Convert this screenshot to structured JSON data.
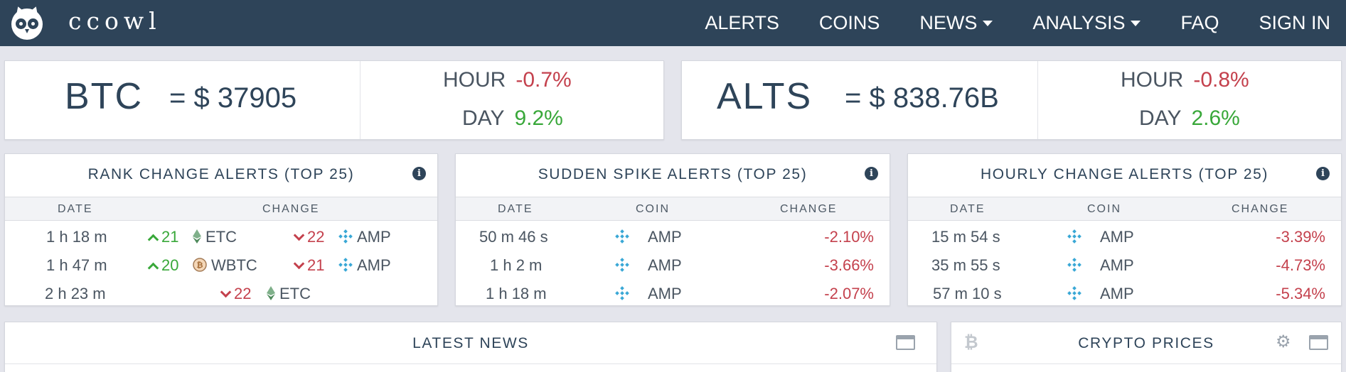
{
  "nav": {
    "brand": "ccowl",
    "links": [
      {
        "label": "ALERTS",
        "has_caret": false
      },
      {
        "label": "COINS",
        "has_caret": false
      },
      {
        "label": "NEWS",
        "has_caret": true
      },
      {
        "label": "ANALYSIS",
        "has_caret": true
      },
      {
        "label": "FAQ",
        "has_caret": false
      },
      {
        "label": "SIGN IN",
        "has_caret": false
      }
    ]
  },
  "btc": {
    "symbol": "BTC",
    "eq_value": "= $ 37905",
    "hour_label": "HOUR",
    "hour_value": "-0.7%",
    "day_label": "DAY",
    "day_value": "9.2%"
  },
  "alts": {
    "symbol": "ALTS",
    "eq_value": "= $ 838.76B",
    "hour_label": "HOUR",
    "hour_value": "-0.8%",
    "day_label": "DAY",
    "day_value": "2.6%"
  },
  "rank_alerts": {
    "title": "RANK CHANGE ALERTS (TOP 25)",
    "headers": {
      "date": "DATE",
      "change": "CHANGE"
    },
    "rows": [
      {
        "date": "1 h 18 m",
        "up_rank": "21",
        "up_coin": "ETC",
        "down_rank": "22",
        "down_coin": "AMP"
      },
      {
        "date": "1 h 47 m",
        "up_rank": "20",
        "up_coin": "WBTC",
        "down_rank": "21",
        "down_coin": "AMP"
      },
      {
        "date": "2 h 23 m",
        "down_rank": "22",
        "down_coin": "ETC"
      }
    ]
  },
  "spike_alerts": {
    "title": "SUDDEN SPIKE ALERTS (TOP 25)",
    "headers": {
      "date": "DATE",
      "coin": "COIN",
      "change": "CHANGE"
    },
    "rows": [
      {
        "date": "50 m 46 s",
        "coin": "AMP",
        "change": "-2.10%"
      },
      {
        "date": "1 h 2 m",
        "coin": "AMP",
        "change": "-3.66%"
      },
      {
        "date": "1 h 18 m",
        "coin": "AMP",
        "change": "-2.07%"
      }
    ]
  },
  "hourly_alerts": {
    "title": "HOURLY CHANGE ALERTS (TOP 25)",
    "headers": {
      "date": "DATE",
      "coin": "COIN",
      "change": "CHANGE"
    },
    "rows": [
      {
        "date": "15 m 54 s",
        "coin": "AMP",
        "change": "-3.39%"
      },
      {
        "date": "35 m 55 s",
        "coin": "AMP",
        "change": "-4.73%"
      },
      {
        "date": "57 m 10 s",
        "coin": "AMP",
        "change": "-5.34%"
      }
    ]
  },
  "latest_news": {
    "title": "LATEST NEWS"
  },
  "crypto_prices": {
    "title": "CRYPTO PRICES"
  },
  "colors": {
    "nav_bg": "#2e4459",
    "negative": "#c4414d",
    "positive": "#39a83a",
    "page_bg": "#e4e5ec"
  }
}
